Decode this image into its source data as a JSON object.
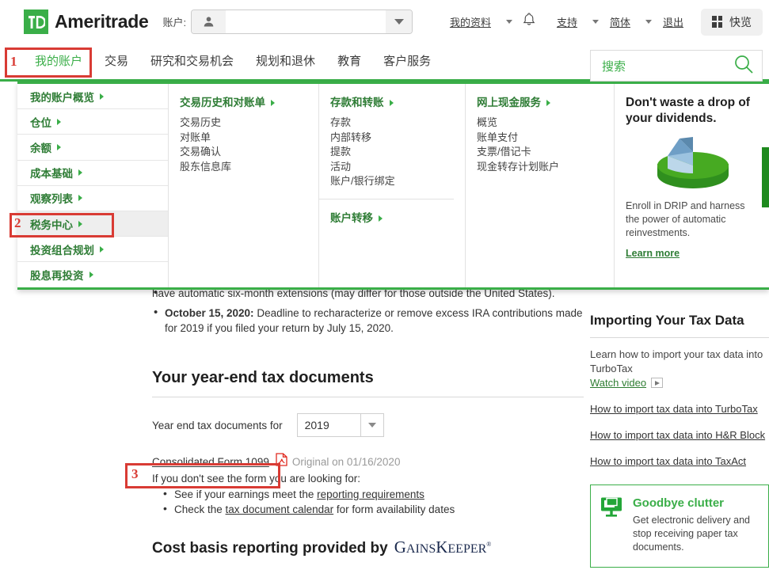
{
  "header": {
    "brand": "Ameritrade",
    "brand_mark": "TD",
    "account_label": "账户:",
    "account_value": "",
    "person_icon": "person-icon",
    "caret_icon": "chevron-down-icon",
    "links": [
      {
        "label": "我的资料",
        "caret": true
      },
      {
        "label": "支持",
        "caret": true
      },
      {
        "label": "简体",
        "caret": true
      },
      {
        "label": "退出",
        "caret": false
      }
    ],
    "bell_icon": "bell-icon",
    "quick_label": "快览",
    "quick_icon": "grid-icon"
  },
  "nav": {
    "items": [
      {
        "label": "我的账户",
        "active": true
      },
      {
        "label": "交易",
        "active": false
      },
      {
        "label": "研究和交易机会",
        "active": false
      },
      {
        "label": "规划和退休",
        "active": false
      },
      {
        "label": "教育",
        "active": false
      },
      {
        "label": "客户服务",
        "active": false
      }
    ],
    "search_placeholder": "搜索",
    "search_icon": "search-icon",
    "accent_color": "#3aae48"
  },
  "mega_menu": {
    "left_items": [
      {
        "label": "我的账户概览",
        "selected": false
      },
      {
        "label": "仓位",
        "selected": false
      },
      {
        "label": "余额",
        "selected": false
      },
      {
        "label": "成本基础",
        "selected": false
      },
      {
        "label": "观察列表",
        "selected": false
      },
      {
        "label": "税务中心",
        "selected": true
      },
      {
        "label": "投资组合规划",
        "selected": false
      },
      {
        "label": "股息再投资",
        "selected": false
      }
    ],
    "columns": [
      {
        "groups": [
          {
            "title": "交易历史和对账单",
            "items": [
              "交易历史",
              "对账单",
              "交易确认",
              "股东信息库"
            ]
          }
        ]
      },
      {
        "groups": [
          {
            "title": "存款和转账",
            "items": [
              "存款",
              "内部转移",
              "提款",
              "活动",
              "账户/银行绑定"
            ]
          },
          {
            "title": "账户转移",
            "items": []
          }
        ]
      },
      {
        "groups": [
          {
            "title": "网上现金服务",
            "items": [
              "概览",
              "账单支付",
              "支票/借记卡",
              "现金转存计划账户"
            ]
          }
        ]
      }
    ],
    "promo": {
      "heading": "Don't waste a drop of your dividends.",
      "art_icon": "pie-chart-3d-icon",
      "body": "Enroll in DRIP and harness the power of automatic reinvestments.",
      "link": "Learn more"
    }
  },
  "main": {
    "top_bullets": [
      {
        "text": "have automatic six-month extensions (may differ for those outside the United States).",
        "bold_prefix": "",
        "partial": true
      },
      {
        "bold_prefix": "October 15, 2020:",
        "text": " Deadline to recharacterize or remove excess IRA contributions made for 2019 if you filed your return by July 15, 2020."
      }
    ],
    "section_title": "Your year-end tax documents",
    "year_label": "Year end tax documents for",
    "year_value": "2019",
    "year_caret_icon": "chevron-down-icon",
    "document_link": "Consolidated Form 1099",
    "document_icon": "pdf-icon",
    "document_status": "Original on 01/16/2020",
    "note": "If you don't see the form you are looking for:",
    "note_bullets": [
      {
        "pre": "See if your earnings meet the ",
        "link": "reporting requirements",
        "post": ""
      },
      {
        "pre": "Check the ",
        "link": "tax document calendar",
        "post": " for form availability dates"
      }
    ],
    "cost_basis_title": "Cost basis reporting provided by",
    "cost_basis_brand": "GAINSKEEPER",
    "cost_basis_brand_parts": {
      "g": "G",
      "ains": "AINS",
      "k": "K",
      "eeper": "EEPER",
      "reg": "®"
    }
  },
  "rail": {
    "title": "Importing Your Tax Data",
    "intro": "Learn how to import your tax data into TurboTax",
    "watch_link": "Watch video",
    "play_icon": "play-icon",
    "links": [
      "How to import tax data into TurboTax",
      "How to import tax data into H&R Block",
      "How to import tax data into TaxAct"
    ],
    "clutter": {
      "icon": "monitor-icon",
      "title": "Goodbye clutter",
      "body": "Get electronic delivery and stop receiving paper tax documents."
    }
  },
  "annotations": [
    {
      "num": "1",
      "target": "我的账户"
    },
    {
      "num": "2",
      "target": "税务中心"
    },
    {
      "num": "3",
      "target": "Consolidated Form 1099"
    }
  ]
}
